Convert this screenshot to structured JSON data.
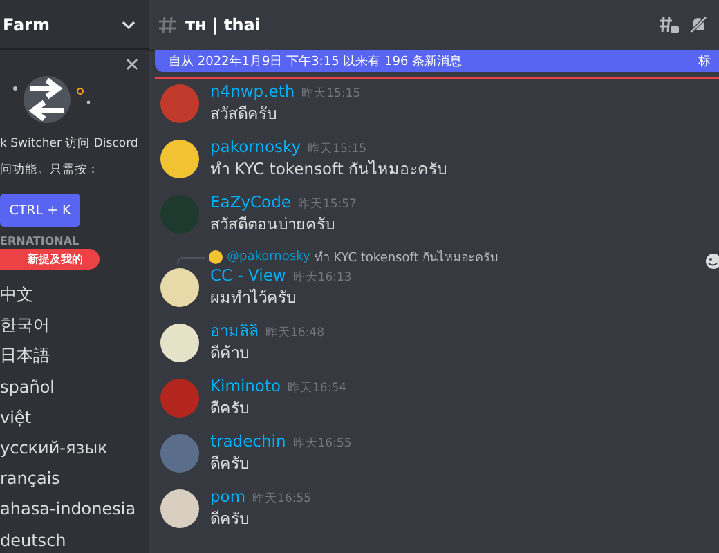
{
  "sidebar": {
    "server_name": "Farm",
    "popup": {
      "text_lines": [
        "k Switcher 访问 Discord",
        "问功能。只需按："
      ],
      "button": "CTRL + K"
    },
    "category": "ERNATIONAL",
    "mention_pill": "新提及我的",
    "channels": [
      {
        "name": "中文"
      },
      {
        "name": "한국어"
      },
      {
        "name": "日本語"
      },
      {
        "name": "spañol"
      },
      {
        "name": "việt"
      },
      {
        "name": "усский-язык"
      },
      {
        "name": "rançais"
      },
      {
        "name": "ahasa-indonesia"
      },
      {
        "name": "deutsch"
      }
    ]
  },
  "channel": {
    "name": "тн | thai"
  },
  "new_messages_bar": {
    "text": "自从 2022年1月9日 下午3:15 以来有 196 条新消息",
    "action": "标"
  },
  "messages": [
    {
      "author": "n4nwp.eth",
      "time": "昨天15:15",
      "text": "สวัสดีครับ",
      "color": "#c0392b"
    },
    {
      "author": "pakornosky",
      "time": "昨天15:15",
      "text": "ทำ KYC tokensoft กันไหมอะครับ",
      "color": "#f1c232"
    },
    {
      "author": "EaZyCode",
      "time": "昨天15:57",
      "text": "สวัสดีตอนบ่ายครับ",
      "color": "#1e3a2f"
    },
    {
      "author": "CC - View",
      "time": "昨天16:13",
      "text": "ผมทำไว้ครับ",
      "color": "#e8d9a8",
      "reply": {
        "author": "@pakornosky",
        "text": "ทำ KYC tokensoft กันไหมอะครับ"
      }
    },
    {
      "author": "อามลิลิ",
      "time": "昨天16:48",
      "text": "ดีค้าบ",
      "color": "#e6e2c8"
    },
    {
      "author": "Kiminoto",
      "time": "昨天16:54",
      "text": "ดีครับ",
      "color": "#b3261e"
    },
    {
      "author": "tradechin",
      "time": "昨天16:55",
      "text": "ดีครับ",
      "color": "#5a6e8c"
    },
    {
      "author": "pom",
      "time": "昨天16:55",
      "text": "ดีครับ",
      "color": "#d9cfc0"
    }
  ]
}
